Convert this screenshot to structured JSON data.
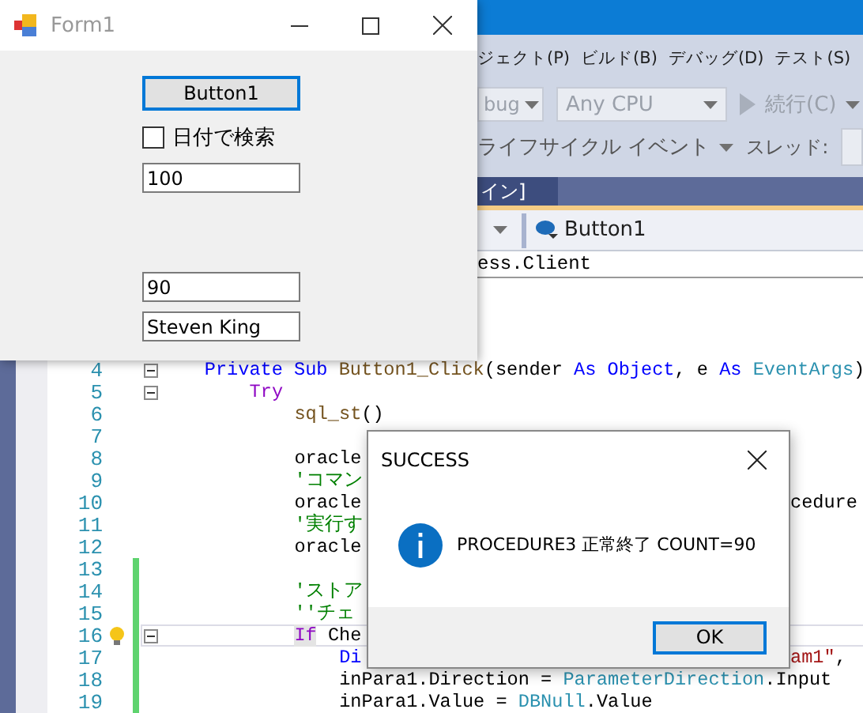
{
  "ide": {
    "menu": [
      "ジェクト(P)",
      "ビルド(B)",
      "デバッグ(D)",
      "テスト(S)"
    ],
    "toolbar": {
      "configuration": "bug",
      "platform": "Any CPU",
      "continue": "続行(C)"
    },
    "toolbar2": {
      "lifecycle": "ライフサイクル イベント",
      "thread_label": "スレッド:"
    },
    "tab": "イン]",
    "nav": {
      "member": "Button1"
    },
    "header_line": "ess.Client",
    "code_lines": [
      {
        "number": "4",
        "fold": true,
        "changed": false,
        "current": false,
        "lightbulb": false,
        "tokens": [
          {
            "kind": "kw",
            "text": "Private Sub "
          },
          {
            "kind": "id",
            "text": "Button1_Click"
          },
          {
            "kind": "plain",
            "text": "(sender "
          },
          {
            "kind": "kw",
            "text": "As Object"
          },
          {
            "kind": "plain",
            "text": ", e "
          },
          {
            "kind": "kw",
            "text": "As "
          },
          {
            "kind": "type",
            "text": "EventArgs"
          },
          {
            "kind": "plain",
            "text": ")"
          }
        ],
        "children": [
          {
            "number": "5",
            "fold": true,
            "changed": false,
            "current": false,
            "lightbulb": false,
            "tokens": [
              {
                "kind": "ctl",
                "text": "Try"
              }
            ],
            "children": [
              {
                "number": "6",
                "fold": false,
                "changed": false,
                "current": false,
                "lightbulb": false,
                "tokens": [
                  {
                    "kind": "id",
                    "text": "sql_st"
                  },
                  {
                    "kind": "plain",
                    "text": "()"
                  }
                ]
              },
              {
                "number": "7",
                "fold": false,
                "changed": false,
                "current": false,
                "lightbulb": false
              },
              {
                "number": "8",
                "fold": false,
                "changed": false,
                "current": false,
                "lightbulb": false,
                "tokens": [
                  {
                    "kind": "plain",
                    "text": "oracle"
                  }
                ]
              },
              {
                "number": "9",
                "fold": false,
                "changed": false,
                "current": false,
                "lightbulb": false,
                "tokens": [
                  {
                    "kind": "cm",
                    "text": "'コマン"
                  }
                ]
              },
              {
                "number": "10",
                "fold": false,
                "changed": false,
                "current": false,
                "lightbulb": false,
                "tokens": [
                  {
                    "kind": "plain",
                    "text": "oracle"
                  }
                ],
                "tail": [
                  {
                    "kind": "plain",
                    "text": "cedure"
                  }
                ]
              },
              {
                "number": "11",
                "fold": false,
                "changed": false,
                "current": false,
                "lightbulb": false,
                "tokens": [
                  {
                    "kind": "cm",
                    "text": "'実行す"
                  }
                ]
              },
              {
                "number": "12",
                "fold": false,
                "changed": false,
                "current": false,
                "lightbulb": false,
                "tokens": [
                  {
                    "kind": "plain",
                    "text": "oracle"
                  }
                ]
              },
              {
                "number": "13",
                "fold": false,
                "changed": true,
                "current": false,
                "lightbulb": false
              },
              {
                "number": "14",
                "fold": false,
                "changed": true,
                "current": false,
                "lightbulb": false,
                "tokens": [
                  {
                    "kind": "cm",
                    "text": "'ストア"
                  }
                ]
              },
              {
                "number": "15",
                "fold": false,
                "changed": true,
                "current": false,
                "lightbulb": false,
                "tokens": [
                  {
                    "kind": "cm",
                    "text": "''チェ"
                  }
                ]
              },
              {
                "number": "16",
                "fold": true,
                "changed": true,
                "current": true,
                "lightbulb": true,
                "tokens": [
                  {
                    "kind": "match",
                    "text": "If"
                  },
                  {
                    "kind": "plain",
                    "text": " Che"
                  }
                ],
                "children": [
                  {
                    "number": "17",
                    "fold": false,
                    "changed": true,
                    "current": false,
                    "lightbulb": false,
                    "tokens": [
                      {
                        "kind": "kw",
                        "text": "Di"
                      }
                    ],
                    "tail": [
                      {
                        "kind": "str",
                        "text": "am1\""
                      },
                      {
                        "kind": "plain",
                        "text": ","
                      }
                    ]
                  },
                  {
                    "number": "18",
                    "fold": false,
                    "changed": true,
                    "current": false,
                    "lightbulb": false,
                    "tokens": [
                      {
                        "kind": "plain",
                        "text": "inPara1.Direction = "
                      },
                      {
                        "kind": "type",
                        "text": "ParameterDirection"
                      },
                      {
                        "kind": "plain",
                        "text": ".Input"
                      }
                    ]
                  },
                  {
                    "number": "19",
                    "fold": false,
                    "changed": true,
                    "current": false,
                    "lightbulb": false,
                    "tokens": [
                      {
                        "kind": "plain",
                        "text": "inPara1.Value = "
                      },
                      {
                        "kind": "type",
                        "text": "DBNull"
                      },
                      {
                        "kind": "plain",
                        "text": ".Value"
                      }
                    ]
                  }
                ]
              }
            ]
          }
        ]
      }
    ]
  },
  "form_window": {
    "title": "Form1",
    "button": "Button1",
    "checkbox": {
      "label": "日付で検索",
      "checked": false
    },
    "fields": [
      {
        "value": "100"
      },
      {
        "value": "90"
      },
      {
        "value": "Steven King"
      }
    ]
  },
  "dialog": {
    "title": "SUCCESS",
    "message": "PROCEDURE3 正常終了 COUNT=90",
    "button": "OK"
  }
}
